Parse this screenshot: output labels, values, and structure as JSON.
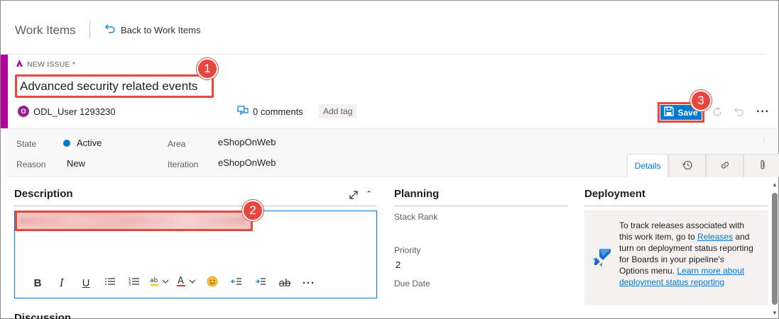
{
  "header": {
    "title": "Work Items",
    "back_label": "Back to Work Items"
  },
  "work_item": {
    "type_label": "NEW ISSUE *",
    "title": "Advanced security related events",
    "assigned_user": "ODL_User 1293230",
    "avatar_initial": "O",
    "comments_label": "0 comments",
    "add_tag_label": "Add tag",
    "save_label": "Save"
  },
  "fields": {
    "state_label": "State",
    "state_value": "Active",
    "reason_label": "Reason",
    "reason_value": "New",
    "area_label": "Area",
    "area_value": "eShopOnWeb",
    "iteration_label": "Iteration",
    "iteration_value": "eShopOnWeb"
  },
  "tabs": [
    {
      "label": "Details",
      "active": true
    },
    {
      "icon": "history-icon"
    },
    {
      "icon": "link-icon"
    },
    {
      "icon": "attachment-icon"
    }
  ],
  "description": {
    "title": "Description"
  },
  "planning": {
    "title": "Planning",
    "stack_rank_label": "Stack Rank",
    "priority_label": "Priority",
    "priority_value": "2",
    "due_date_label": "Due Date"
  },
  "deployment": {
    "title": "Deployment",
    "text_1": "To track releases associated with this work item, go to ",
    "link_releases": "Releases",
    "text_2": " and turn on deployment status reporting for Boards in your pipeline's Options menu. ",
    "link_learn": "Learn more about deployment status reporting"
  },
  "discussion": {
    "title": "Discussion"
  },
  "annotations": {
    "badge_1": "1",
    "badge_2": "2",
    "badge_3": "3"
  },
  "colors": {
    "accent_bar": "#b4009e",
    "primary": "#0078d4",
    "annotation_red": "#e8473f"
  }
}
